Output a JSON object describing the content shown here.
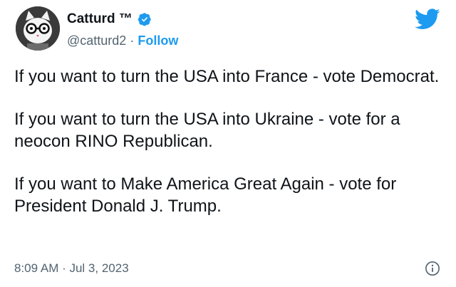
{
  "author": {
    "name": "Catturd ™",
    "handle": "@catturd2",
    "separator": "·",
    "follow_label": "Follow",
    "avatar_icon": "cat-with-glasses-avatar",
    "verified_icon": "verified-badge-icon"
  },
  "platform_icon": "twitter-bird-icon",
  "tweet": {
    "paragraphs": [
      "If you want to turn the USA into France - vote Democrat.",
      "If you want to turn the USA into Ukraine - vote for a neocon RINO Republican.",
      "If you want to Make America Great Again - vote for President Donald J. Trump."
    ],
    "timestamp": "8:09 AM · Jul 3, 2023"
  },
  "colors": {
    "accent": "#1d9bf0",
    "text_primary": "#0f1419",
    "text_secondary": "#536471"
  }
}
